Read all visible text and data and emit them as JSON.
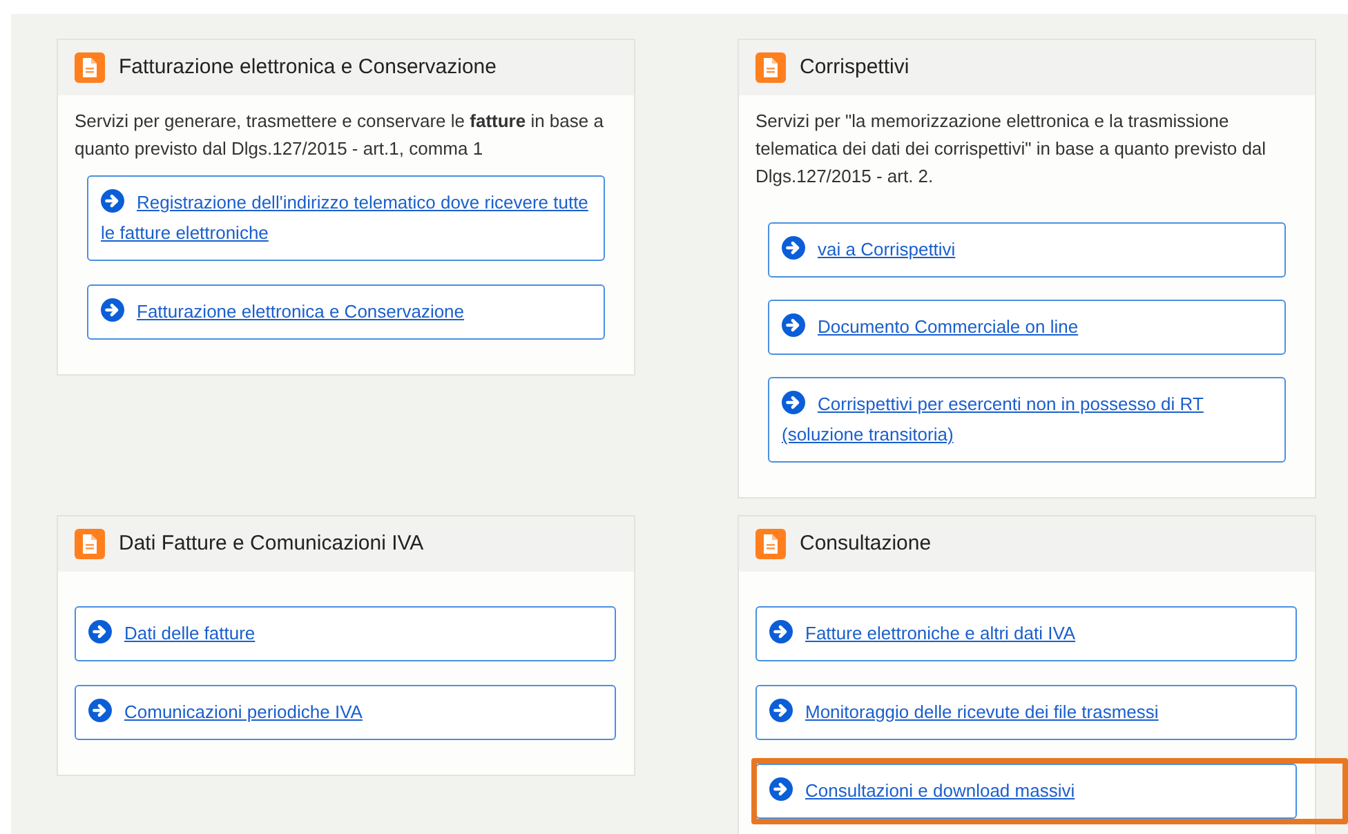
{
  "cards": [
    {
      "title": "Fatturazione elettronica e Conservazione",
      "description": "Servizi per generare, trasmettere e conservare le **fatture** in base a quanto previsto dal Dlgs.127/2015 - art.1, comma 1",
      "links": [
        {
          "label": "Registrazione dell'indirizzo telematico dove ricevere tutte le fatture elettroniche",
          "highlighted": false
        },
        {
          "label": "Fatturazione elettronica e Conservazione",
          "highlighted": false
        }
      ]
    },
    {
      "title": "Corrispettivi",
      "description": "Servizi per \"la memorizzazione elettronica e la trasmissione telematica dei dati dei corrispettivi\" in base a quanto previsto dal Dlgs.127/2015 - art. 2.",
      "links": [
        {
          "label": "vai a Corrispettivi",
          "highlighted": false
        },
        {
          "label": "Documento Commerciale on line",
          "highlighted": false
        },
        {
          "label": "Corrispettivi per esercenti non in possesso di RT (soluzione transitoria)",
          "highlighted": false
        }
      ]
    },
    {
      "title": "Dati Fatture e Comunicazioni IVA",
      "links": [
        {
          "label": "Dati delle fatture",
          "highlighted": false
        },
        {
          "label": "Comunicazioni periodiche IVA",
          "highlighted": false
        }
      ]
    },
    {
      "title": "Consultazione",
      "links": [
        {
          "label": "Fatture elettroniche e altri dati IVA",
          "highlighted": false
        },
        {
          "label": "Monitoraggio delle ricevute dei file trasmessi",
          "highlighted": false
        },
        {
          "label": "Consultazioni e download massivi",
          "highlighted": true
        }
      ]
    }
  ]
}
